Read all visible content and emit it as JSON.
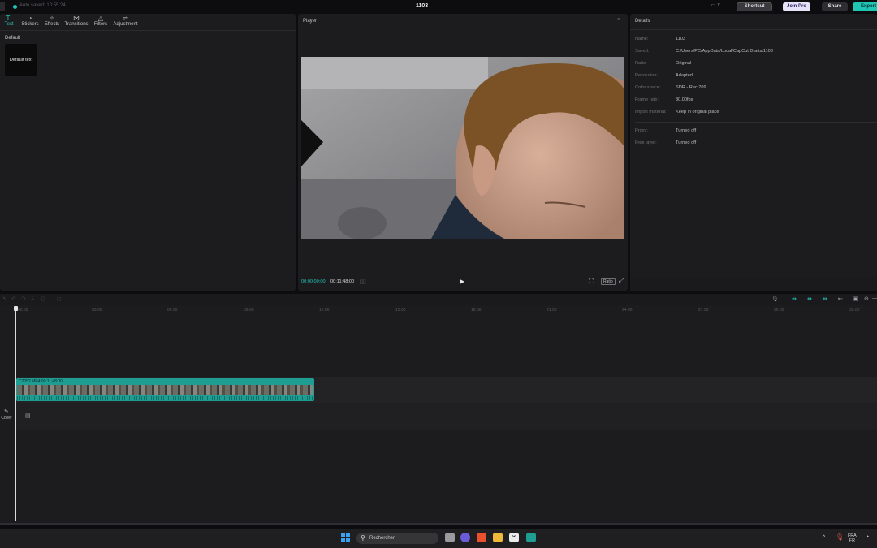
{
  "titlebar": {
    "autosave": "Auto saved: 10:55:24",
    "project_title": "1103",
    "layout_icon": "layout-icon",
    "shortcut_label": "Shortcut",
    "joinpro_label": "Join Pro",
    "share_label": "Share",
    "export_label": "Export"
  },
  "left_panel": {
    "tools": [
      {
        "label": "Text",
        "icon": "TI"
      },
      {
        "label": "Stickers",
        "icon": "◔"
      },
      {
        "label": "Effects",
        "icon": "✧"
      },
      {
        "label": "Transitions",
        "icon": "⋈"
      },
      {
        "label": "Filters",
        "icon": "◬"
      },
      {
        "label": "Adjustment",
        "icon": "⇌"
      }
    ],
    "section_label": "Default",
    "tile_label": "Default text"
  },
  "player": {
    "title": "Player",
    "time_current": "00:00:00:00",
    "time_total": "00:11:48:00",
    "ratio_label": "Ratio"
  },
  "details": {
    "title": "Details",
    "rows": [
      {
        "label": "Name:",
        "value": "1103"
      },
      {
        "label": "Saved:",
        "value": "C:/Users/PC/AppData/Local/CapCut Drafts/1103"
      },
      {
        "label": "Ratio:",
        "value": "Original"
      },
      {
        "label": "Resolution:",
        "value": "Adapted"
      },
      {
        "label": "Color space:",
        "value": "SDR - Rec.709"
      },
      {
        "label": "Frame rate:",
        "value": "30.00fps"
      },
      {
        "label": "Import material:",
        "value": "Keep in original place"
      }
    ],
    "rows2": [
      {
        "label": "Proxy:",
        "value": "Turned off"
      },
      {
        "label": "Free layer:",
        "value": "Turned off"
      }
    ]
  },
  "timeline": {
    "ruler_ticks": [
      "00:00",
      "03:00",
      "06:00",
      "09:00",
      "12:00",
      "15:00",
      "18:00",
      "21:00",
      "24:00",
      "27:00",
      "30:00",
      "33:00"
    ],
    "clip_label": "C2052.MP4   00:11:48:00",
    "cover_label": "Cover"
  },
  "taskbar": {
    "search_text": "Rechercher",
    "lang_top": "FRA",
    "lang_bottom": "FR"
  },
  "colors": {
    "accent": "#22c3b8",
    "clip": "#1e9e93",
    "panel": "#1c1c1e"
  }
}
